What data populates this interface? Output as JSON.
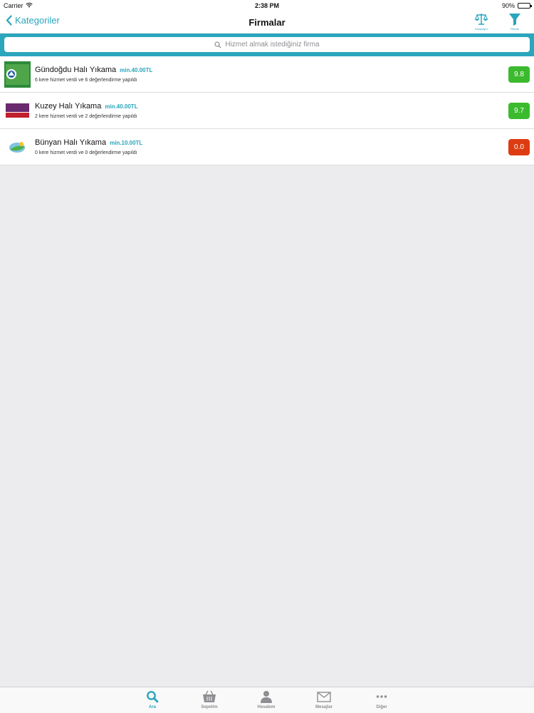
{
  "status_bar": {
    "carrier": "Carrier",
    "time": "2:38 PM",
    "battery_text": "90%",
    "battery_level": 0.9
  },
  "nav": {
    "back_label": "Kategoriler",
    "title": "Firmalar",
    "compare_label": "Karşılaştır",
    "filter_label": "Filtrele"
  },
  "search": {
    "placeholder": "Hizmet almak istediğiniz firma"
  },
  "colors": {
    "accent": "#29a5bc",
    "band": "#2ba6bd",
    "score_good": "#3cba2e",
    "score_bad": "#dd3c12"
  },
  "companies": [
    {
      "name": "Gündoğdu Halı Yıkama",
      "min_price": "min.40.00TL",
      "stats": "6 kere hizmet verdi ve 6 değerlendirme yapıldı",
      "score": "9.8",
      "logo_icon": "gundogdu-logo",
      "logo_text": "Gündoğdu Halı Yıkama"
    },
    {
      "name": "Kuzey Halı Yıkama",
      "min_price": "min.40.00TL",
      "stats": "2 kere hizmet verdi ve 2 değerlendirme yapıldı",
      "score": "9.7",
      "logo_icon": "kuzey-logo",
      "logo_text_top": "kuzey",
      "logo_text_bottom": "HALI YIKAMA"
    },
    {
      "name": "Bünyan Halı Yıkama",
      "min_price": "min.10.00TL",
      "stats": "0 kere hizmet verdi ve 0 değerlendirme yapıldı",
      "score": "0.0",
      "logo_icon": "bunyan-logo"
    }
  ],
  "tabs": [
    {
      "label": "Ara",
      "icon": "search-icon",
      "active": true
    },
    {
      "label": "Sepetim",
      "icon": "basket-icon",
      "active": false
    },
    {
      "label": "Hesabım",
      "icon": "person-icon",
      "active": false
    },
    {
      "label": "Mesajlar",
      "icon": "envelope-icon",
      "active": false
    },
    {
      "label": "Diğer",
      "icon": "more-icon",
      "active": false
    }
  ]
}
